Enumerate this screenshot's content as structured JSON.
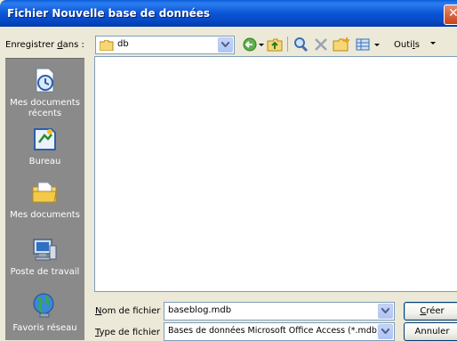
{
  "window": {
    "title": "Fichier Nouvelle base de données",
    "close_glyph": "✕"
  },
  "lookin": {
    "label_pre": "Enregistrer ",
    "label_key": "d",
    "label_post": "ans :",
    "value": "db"
  },
  "toolbar": {
    "icons": [
      "back-icon",
      "up-folder-icon",
      "search-web-icon",
      "delete-icon",
      "new-folder-icon",
      "views-icon"
    ],
    "tools_pre": "Outi",
    "tools_key": "l",
    "tools_post": "s"
  },
  "places": [
    {
      "label": "Mes documents récents",
      "icon": "recent-documents-icon"
    },
    {
      "label": "Bureau",
      "icon": "desktop-icon"
    },
    {
      "label": "Mes documents",
      "icon": "my-documents-icon"
    },
    {
      "label": "Poste de travail",
      "icon": "my-computer-icon"
    },
    {
      "label": "Favoris réseau",
      "icon": "network-places-icon"
    }
  ],
  "filename": {
    "label_key": "N",
    "label_rest": "om de fichier :",
    "value": "baseblog.mdb"
  },
  "filetype": {
    "label_key": "T",
    "label_rest": "ype de fichier :",
    "value": "Bases de données Microsoft Office Access (*.mdb)"
  },
  "buttons": {
    "create_key": "C",
    "create_rest": "réer",
    "cancel": "Annuler"
  },
  "colors": {
    "title_bar": "#0a56d6",
    "places_bar": "#8a8a8a",
    "dialog_bg": "#ece9d8",
    "close_button": "#c8431c"
  }
}
